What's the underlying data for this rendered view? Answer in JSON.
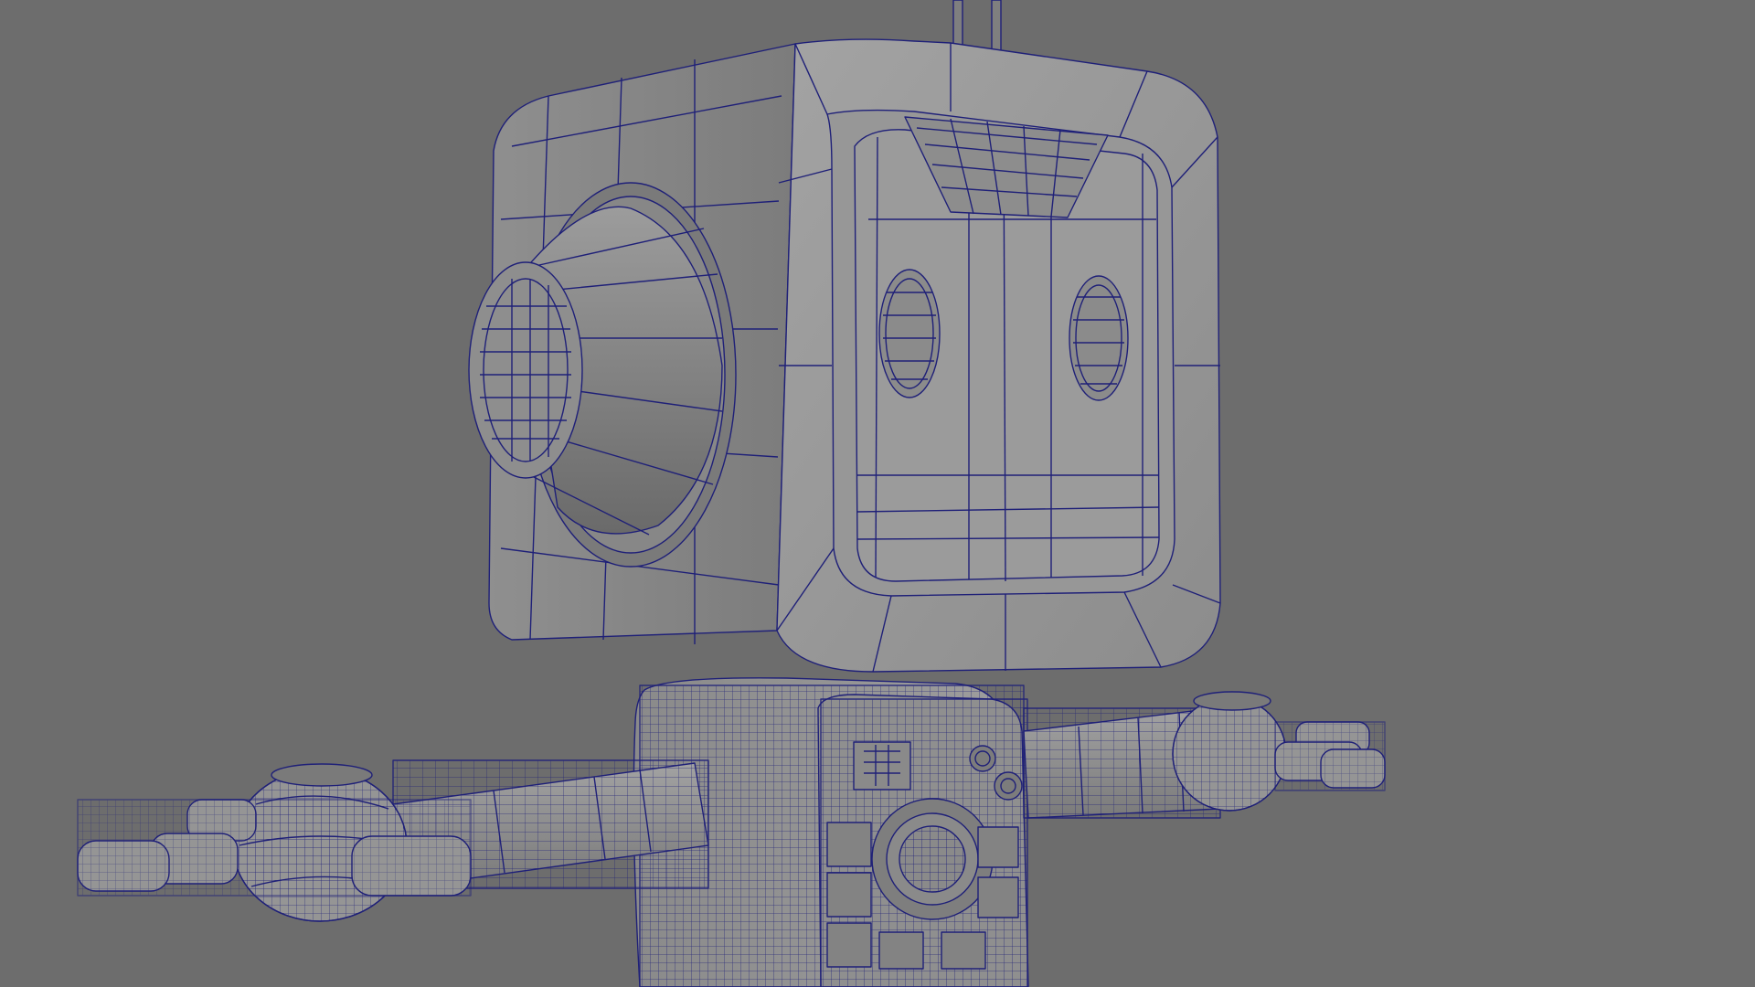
{
  "viewport": {
    "background": "#6d6d6d",
    "wire_color": "#1f2078",
    "face_light": "#9a9a9a",
    "face_mid": "#8a8a8a",
    "face_dark": "#6a6a6a"
  },
  "model": {
    "icon": "wireframe-robot-icon",
    "parts": [
      "head",
      "antenna",
      "eyes",
      "brow-visor",
      "ear-cone",
      "torso",
      "chest-panel",
      "left-arm",
      "right-arm",
      "hands"
    ]
  }
}
